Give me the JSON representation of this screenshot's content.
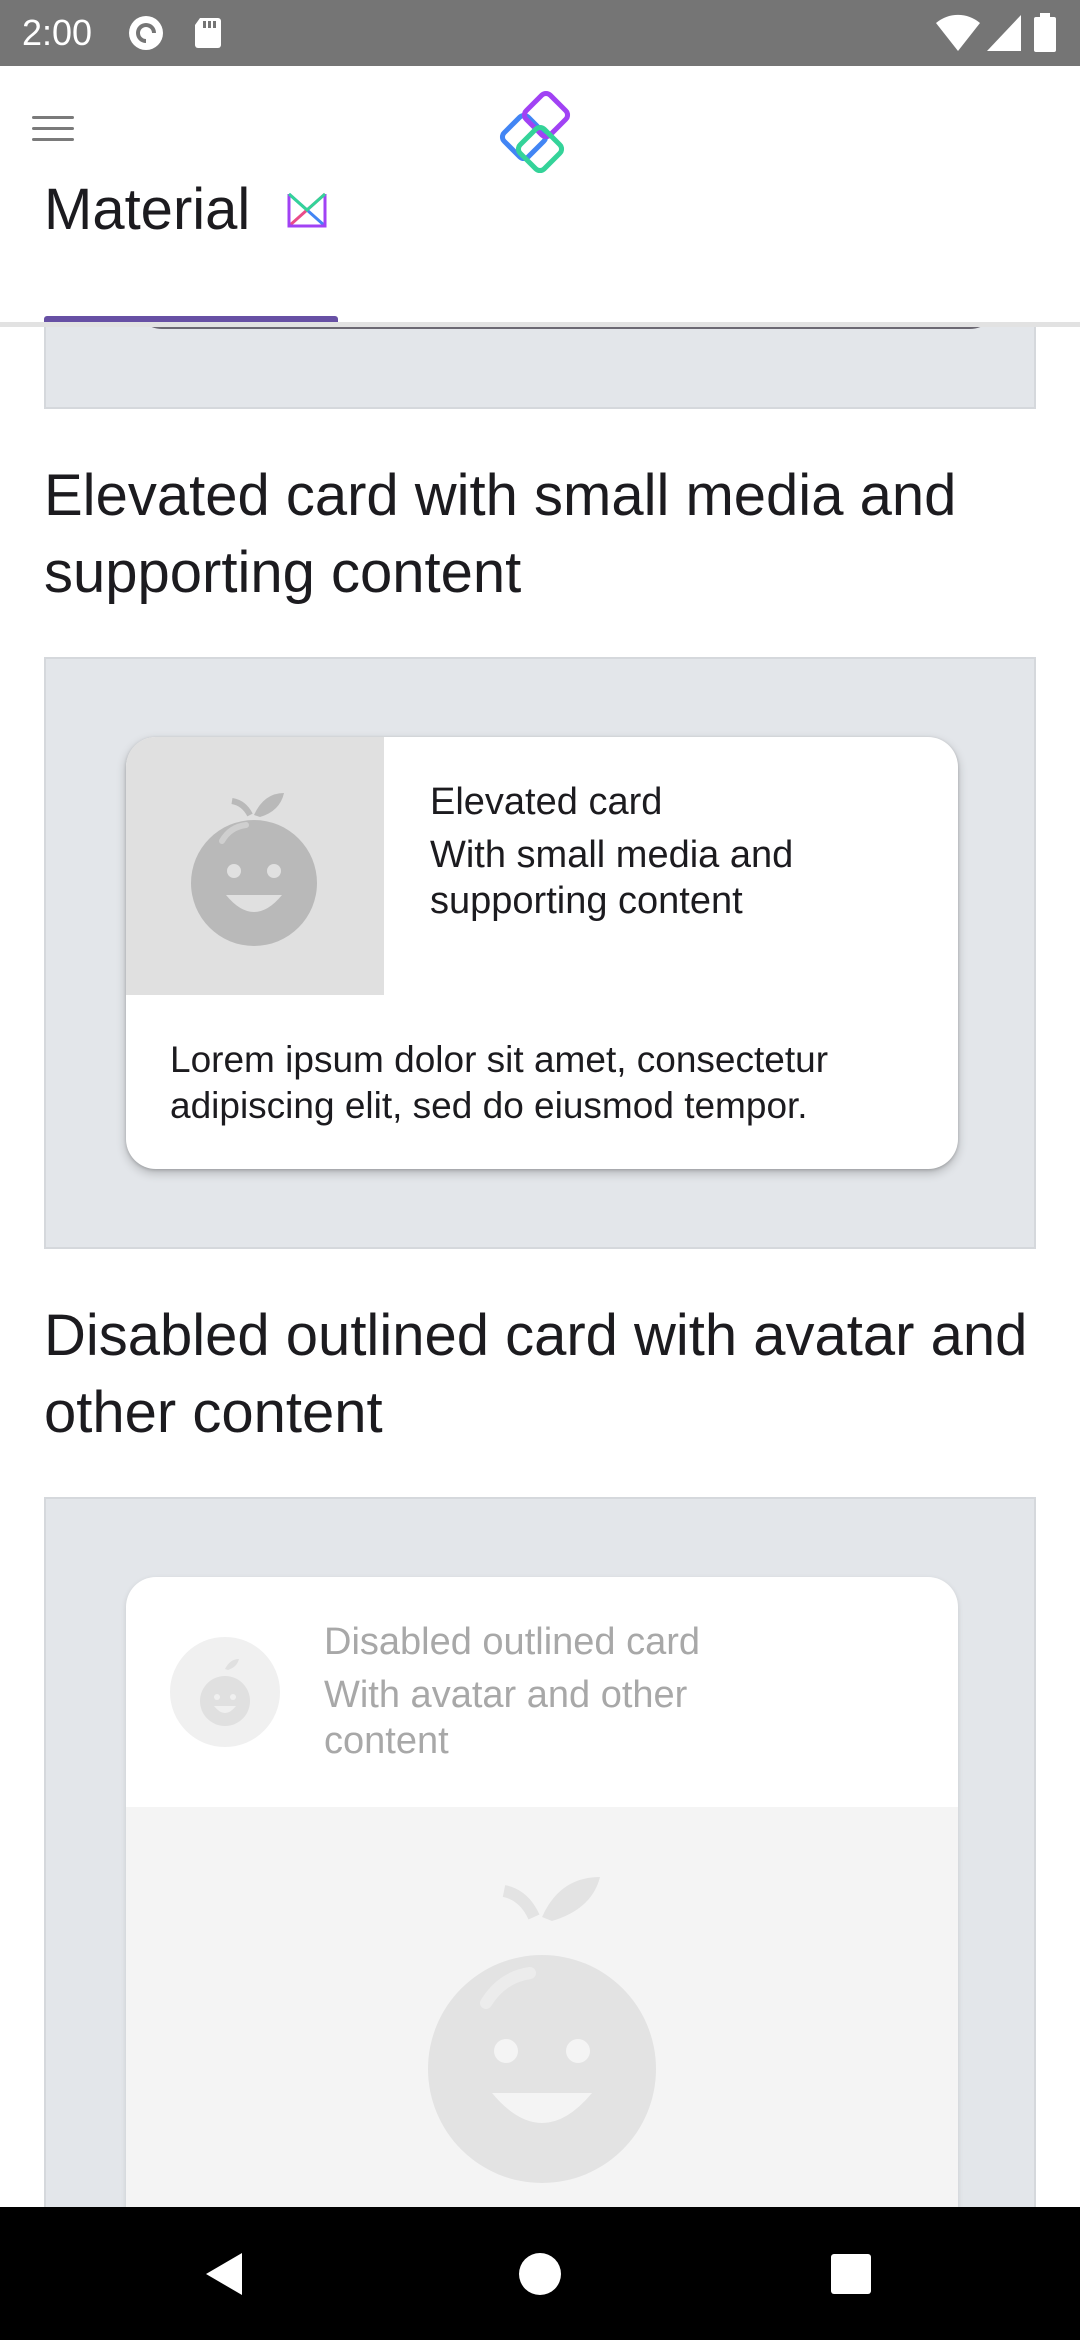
{
  "status_bar": {
    "time": "2:00",
    "left_icons": [
      "pocket-casts-icon",
      "sd-card-icon"
    ],
    "right_icons": [
      "wifi-icon",
      "cell-signal-icon",
      "battery-icon"
    ]
  },
  "app_bar": {
    "menu_icon": "hamburger-menu-icon",
    "logo_icon": "jetpack-compose-catalog-logo",
    "tab": {
      "label": "Material",
      "icon": "material-design-icon"
    },
    "accent_color": "#6750a4"
  },
  "sections": [
    {
      "title": "Elevated card with small media and supporting content",
      "card": {
        "title": "Elevated card",
        "subtitle_line1": "With small media and",
        "subtitle_line2": "supporting content",
        "body_line1": "Lorem ipsum dolor sit amet, consectetur",
        "body_line2": "adipiscing elit, sed do eiusmod tempor.",
        "media_icon": "fruit-face-icon"
      }
    },
    {
      "title": "Disabled outlined card with avatar and other content",
      "card": {
        "title": "Disabled outlined card",
        "subtitle_line1": "With avatar and other",
        "subtitle_line2": "content",
        "avatar_icon": "fruit-face-icon",
        "media_icon": "fruit-face-icon"
      }
    }
  ],
  "nav_bar": {
    "back_icon": "back-triangle-icon",
    "home_icon": "home-circle-icon",
    "recents_icon": "recents-square-icon"
  }
}
